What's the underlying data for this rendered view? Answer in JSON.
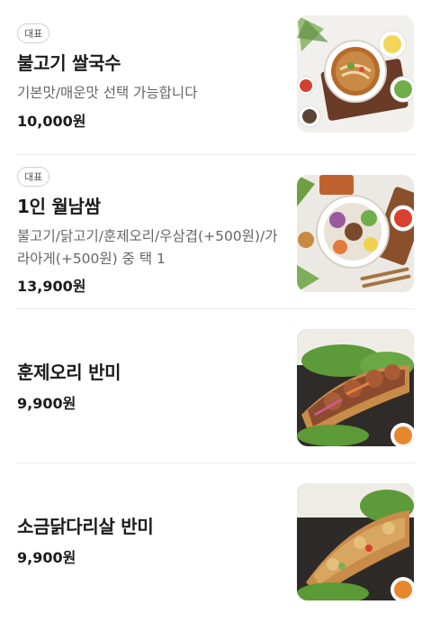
{
  "menu": {
    "items": [
      {
        "badge": "대표",
        "name": "불고기 쌀국수",
        "description": "기본맛/매운맛 선택 가능합니다",
        "price": "10,000원"
      },
      {
        "badge": "대표",
        "name": "1인 월남쌈",
        "description": "불고기/닭고기/훈제오리/우삼겹(+500원)/가라아게(+500원) 중 택 1",
        "price": "13,900원"
      },
      {
        "name": "훈제오리 반미",
        "price": "9,900원"
      },
      {
        "name": "소금닭다리살 반미",
        "price": "9,900원"
      }
    ]
  }
}
